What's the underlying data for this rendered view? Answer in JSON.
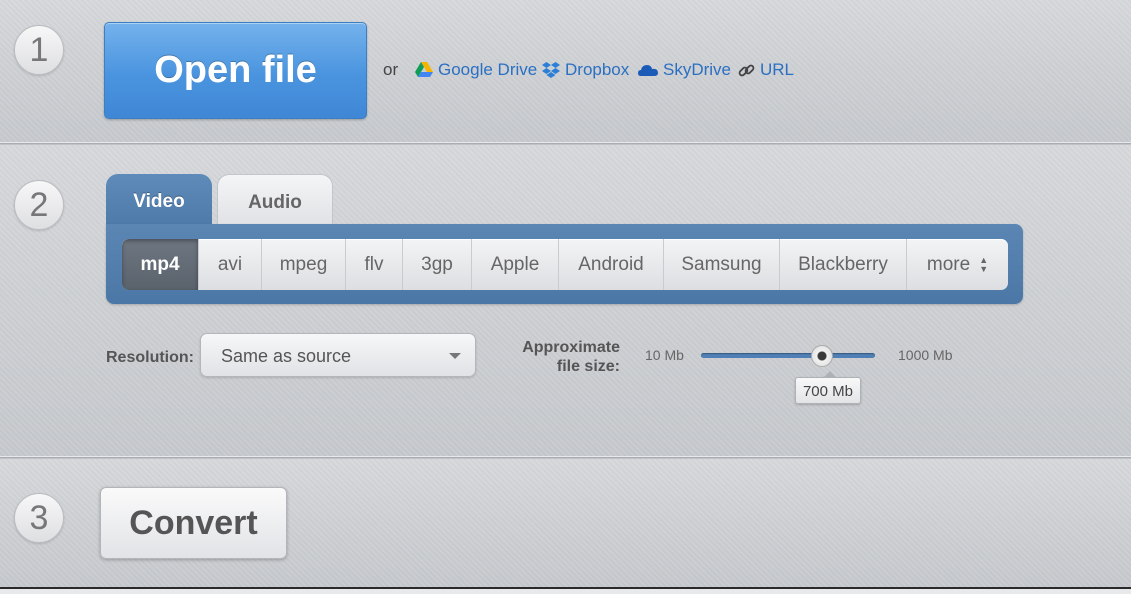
{
  "steps": [
    "1",
    "2",
    "3"
  ],
  "open": {
    "button_label": "Open file",
    "or_text": "or",
    "sources": [
      {
        "label": "Google Drive",
        "icon": "google-drive-icon"
      },
      {
        "label": "Dropbox",
        "icon": "dropbox-icon"
      },
      {
        "label": "SkyDrive",
        "icon": "skydrive-icon"
      },
      {
        "label": "URL",
        "icon": "link-icon"
      }
    ]
  },
  "tabs": [
    {
      "label": "Video",
      "active": true
    },
    {
      "label": "Audio",
      "active": false
    }
  ],
  "formats": [
    {
      "label": "mp4",
      "active": true
    },
    {
      "label": "avi"
    },
    {
      "label": "mpeg"
    },
    {
      "label": "flv"
    },
    {
      "label": "3gp"
    },
    {
      "label": "Apple"
    },
    {
      "label": "Android"
    },
    {
      "label": "Samsung"
    },
    {
      "label": "Blackberry"
    },
    {
      "label": "more"
    }
  ],
  "resolution": {
    "label": "Resolution:",
    "value": "Same as source"
  },
  "file_size": {
    "label_line1": "Approximate",
    "label_line2": "file size:",
    "min_label": "10 Mb",
    "max_label": "1000 Mb",
    "min": 10,
    "max": 1000,
    "value": 700,
    "value_label": "700 Mb"
  },
  "convert": {
    "button_label": "Convert"
  },
  "colors": {
    "accent_blue": "#4a94df",
    "panel_blue": "#4e7aa9",
    "link_blue": "#2b6fc2"
  }
}
